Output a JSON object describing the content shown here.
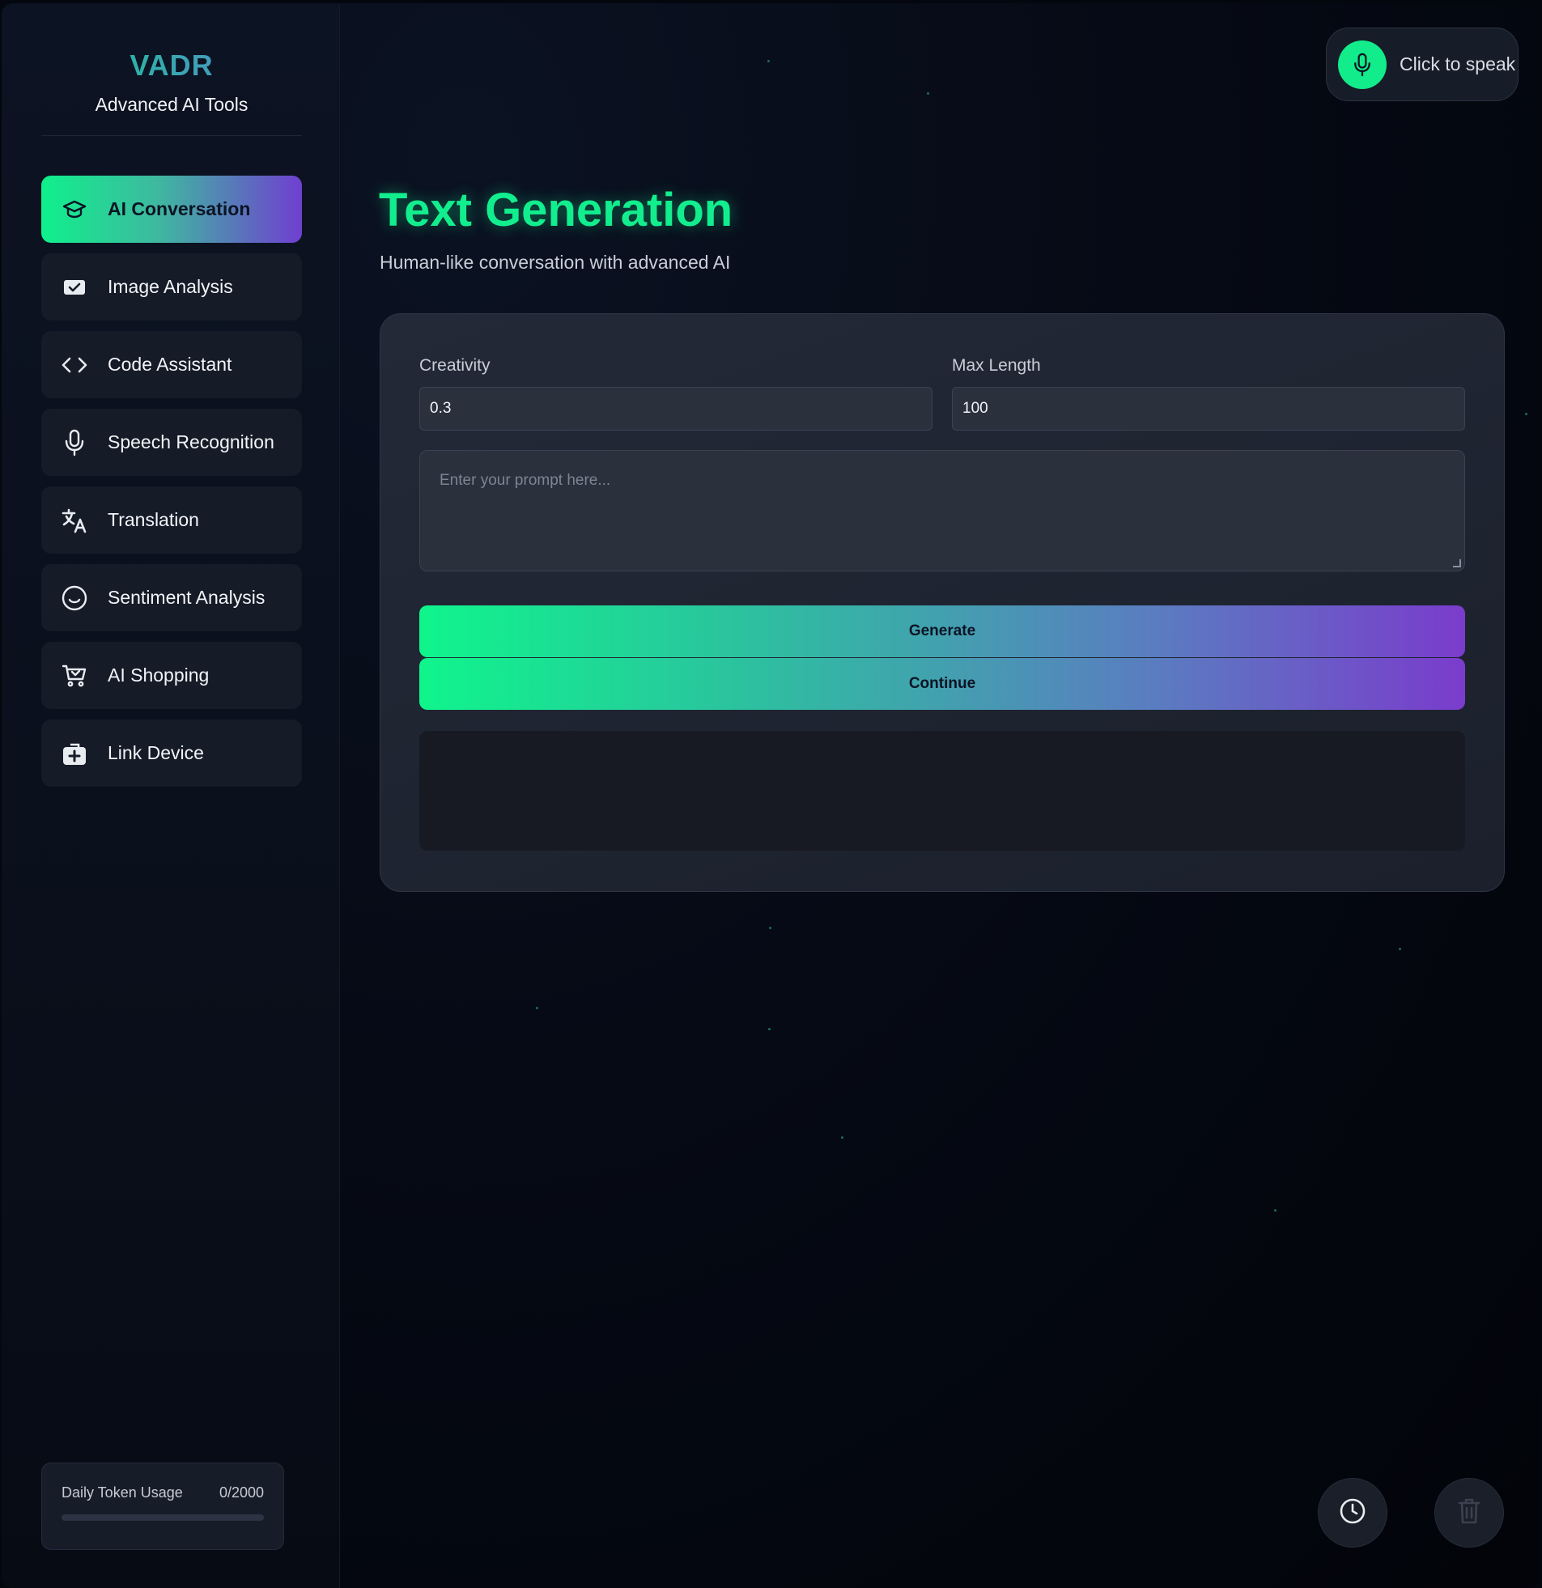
{
  "brand": {
    "title": "VADR",
    "subtitle": "Advanced AI Tools"
  },
  "sidebar": {
    "items": [
      {
        "label": "AI Conversation",
        "icon": "graduation-cap-icon",
        "active": true
      },
      {
        "label": "Image Analysis",
        "icon": "image-check-icon",
        "active": false
      },
      {
        "label": "Code Assistant",
        "icon": "code-brackets-icon",
        "active": false
      },
      {
        "label": "Speech Recognition",
        "icon": "microphone-icon",
        "active": false
      },
      {
        "label": "Translation",
        "icon": "translate-icon",
        "active": false
      },
      {
        "label": "Sentiment Analysis",
        "icon": "smile-icon",
        "active": false
      },
      {
        "label": "AI Shopping",
        "icon": "shopping-cart-icon",
        "active": false
      },
      {
        "label": "Link Device",
        "icon": "device-plus-icon",
        "active": false
      }
    ]
  },
  "usage": {
    "label": "Daily Token Usage",
    "value": "0/2000",
    "fraction": 0
  },
  "voice": {
    "label": "Click to speak",
    "icon": "microphone-icon"
  },
  "main": {
    "title": "Text Generation",
    "subtitle": "Human-like conversation with advanced AI"
  },
  "form": {
    "creativity_label": "Creativity",
    "creativity_value": "0.3",
    "max_length_label": "Max Length",
    "max_length_value": "100",
    "prompt_placeholder": "Enter your prompt here...",
    "generate_label": "Generate",
    "continue_label": "Continue",
    "output_text": ""
  },
  "footer": {
    "history_icon": "clock-icon",
    "delete_icon": "trash-icon"
  },
  "colors": {
    "accent_green": "#12ee8e",
    "accent_purple": "#7a3ccc",
    "background": "#04070e"
  }
}
